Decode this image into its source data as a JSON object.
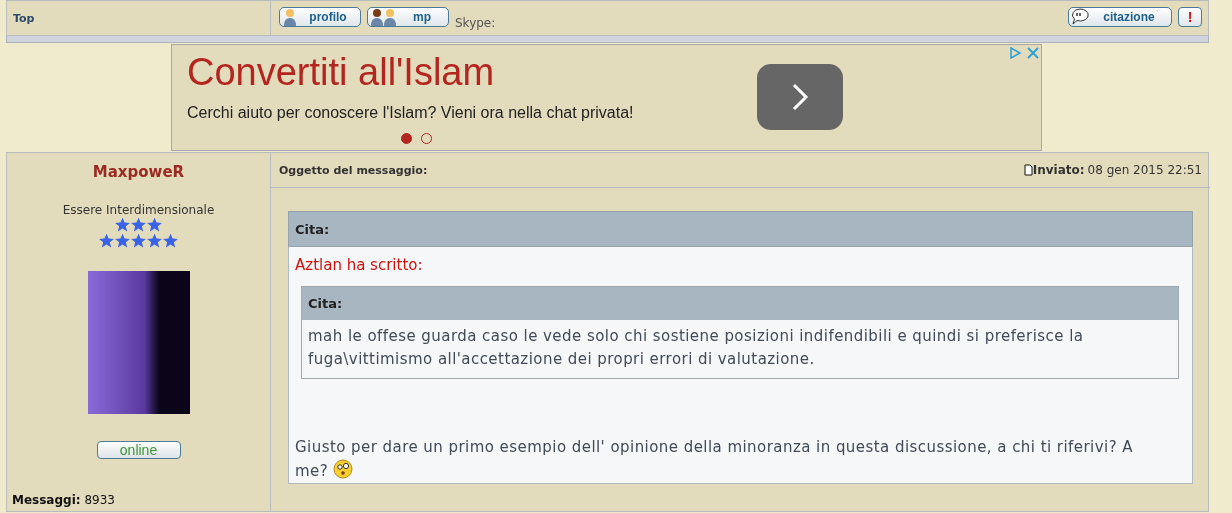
{
  "top_row": {
    "label": "Top",
    "buttons": [
      {
        "kind": "profile",
        "label": "profilo"
      },
      {
        "kind": "pm",
        "label": "mp"
      }
    ],
    "skype_label": "Skype:",
    "quote_button": "citazione",
    "report_button": "!"
  },
  "ad": {
    "headline": "Convertiti all'Islam",
    "text": "Cerchi aiuto per conoscere l'Islam? Vieni ora nella chat privata!",
    "dots": [
      {
        "selected": true
      },
      {
        "selected": false
      }
    ]
  },
  "post": {
    "author": "MaxpoweR",
    "rank": "Essere Interdimensionale",
    "status": "online",
    "posts_label": "Messaggi:",
    "posts_value": "8933",
    "subject_label": "Oggetto del messaggio:",
    "sent_label": "Inviato:",
    "sent_value": "08 gen 2015 22:51",
    "quote": {
      "title": "Cita:",
      "author_line": "Aztlan ha scritto:",
      "inner_quote": {
        "title": "Cita:",
        "text": "mah le offese guarda caso le vede solo chi sostiene posizioni indifendibili e quindi si preferisce la fuga\\vittimismo all'accettazione dei propri errori di valutazione."
      }
    },
    "body": "Giusto per dare un primo esempio dell' opinione della minoranza in questa discussione, a chi ti riferivi? A me?"
  }
}
